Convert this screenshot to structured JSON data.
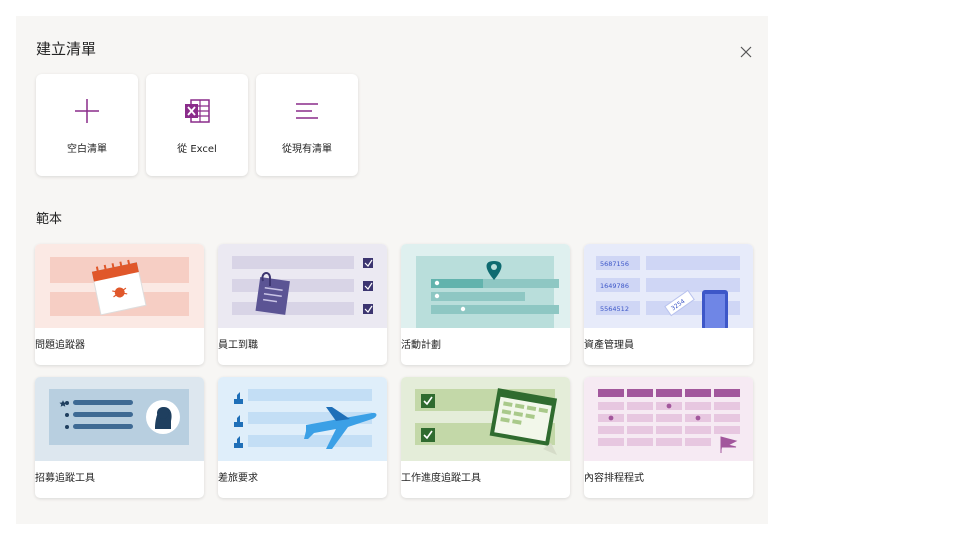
{
  "dialog": {
    "title": "建立清單",
    "close_icon": "close-icon"
  },
  "create_options": [
    {
      "label": "空白清單",
      "icon": "plus-icon"
    },
    {
      "label": "從 Excel",
      "icon": "excel-icon"
    },
    {
      "label": "從現有清單",
      "icon": "list-lines-icon"
    }
  ],
  "templates_section": {
    "title": "範本"
  },
  "templates": [
    {
      "label": "問題追蹤器",
      "icon": "calendar-bug-illustration",
      "bg": "#fbe9e4"
    },
    {
      "label": "員工到職",
      "icon": "clipboard-checklist-illustration",
      "bg": "#ebe9f2"
    },
    {
      "label": "活動計劃",
      "icon": "map-pin-list-illustration",
      "bg": "#dff0ef"
    },
    {
      "label": "資產管理員",
      "icon": "asset-tags-illustration",
      "bg": "#e7ebfa",
      "ids": [
        "5687156",
        "1649786",
        "5564512"
      ],
      "tag": "3254"
    },
    {
      "label": "招募追蹤工具",
      "icon": "candidate-list-illustration",
      "bg": "#dde7ef"
    },
    {
      "label": "差旅要求",
      "icon": "airplane-illustration",
      "bg": "#dfeefa"
    },
    {
      "label": "工作進度追蹤工具",
      "icon": "checked-schedule-illustration",
      "bg": "#e4edd9"
    },
    {
      "label": "內容排程程式",
      "icon": "calendar-flag-illustration",
      "bg": "#f6eaf3"
    }
  ],
  "colors": {
    "accent_purple": "#8a2c8a",
    "excel_purple": "#8a2c8a",
    "dialog_bg": "#f7f6f4"
  }
}
